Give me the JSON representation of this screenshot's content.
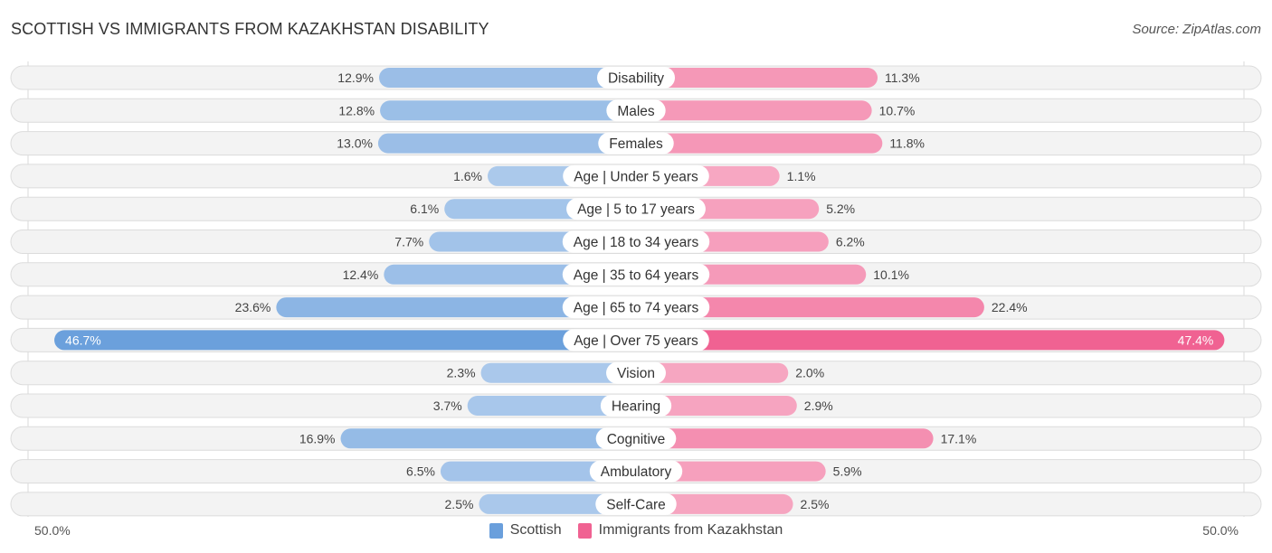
{
  "title": "SCOTTISH VS IMMIGRANTS FROM KAZAKHSTAN DISABILITY",
  "source": "Source: ZipAtlas.com",
  "axis": {
    "left_label": "50.0%",
    "right_label": "50.0%"
  },
  "legend": [
    {
      "name": "Scottish",
      "color": "#6a9fdc"
    },
    {
      "name": "Immigrants from Kazakhstan",
      "color": "#f06292"
    }
  ],
  "chart_data": {
    "type": "bar",
    "orientation": "horizontal-diverging",
    "title": "SCOTTISH VS IMMIGRANTS FROM KAZAKHSTAN DISABILITY",
    "xlim": [
      -50,
      50
    ],
    "unit": "%",
    "categories": [
      "Disability",
      "Males",
      "Females",
      "Age | Under 5 years",
      "Age | 5 to 17 years",
      "Age | 18 to 34 years",
      "Age | 35 to 64 years",
      "Age | 65 to 74 years",
      "Age | Over 75 years",
      "Vision",
      "Hearing",
      "Cognitive",
      "Ambulatory",
      "Self-Care"
    ],
    "series": [
      {
        "name": "Scottish",
        "side": "left",
        "color": "#6a9fdc",
        "values": [
          12.9,
          12.8,
          13.0,
          1.6,
          6.1,
          7.7,
          12.4,
          23.6,
          46.7,
          2.3,
          3.7,
          16.9,
          6.5,
          2.5
        ],
        "labels": [
          "12.9%",
          "12.8%",
          "13.0%",
          "1.6%",
          "6.1%",
          "7.7%",
          "12.4%",
          "23.6%",
          "46.7%",
          "2.3%",
          "3.7%",
          "16.9%",
          "6.5%",
          "2.5%"
        ]
      },
      {
        "name": "Immigrants from Kazakhstan",
        "side": "right",
        "color": "#f06292",
        "values": [
          11.3,
          10.7,
          11.8,
          1.1,
          5.2,
          6.2,
          10.1,
          22.4,
          47.4,
          2.0,
          2.9,
          17.1,
          5.9,
          2.5
        ],
        "labels": [
          "11.3%",
          "10.7%",
          "11.8%",
          "1.1%",
          "5.2%",
          "6.2%",
          "10.1%",
          "22.4%",
          "47.4%",
          "2.0%",
          "2.9%",
          "17.1%",
          "5.9%",
          "2.5%"
        ]
      }
    ],
    "legend_position": "bottom-center",
    "grid": false
  }
}
